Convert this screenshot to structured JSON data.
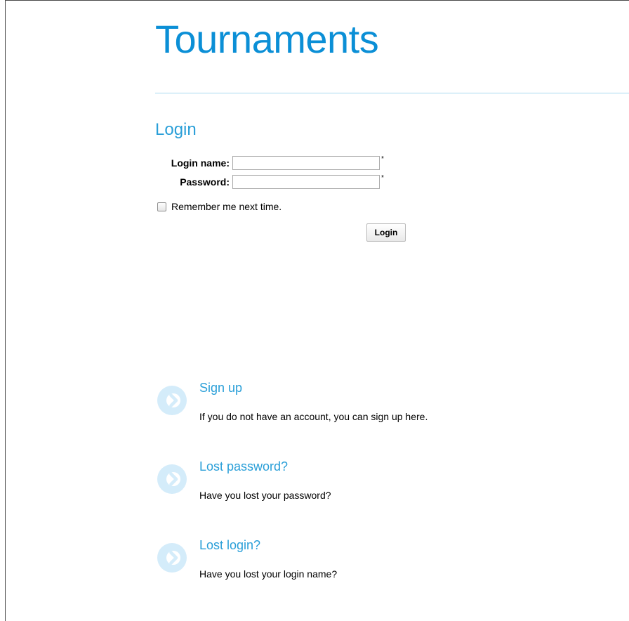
{
  "header": {
    "site_title": "Tournaments"
  },
  "login_form": {
    "heading": "Login",
    "login_name_label": "Login name:",
    "login_name_value": "",
    "password_label": "Password:",
    "password_value": "",
    "required_marker": "*",
    "remember_label": "Remember me next time.",
    "remember_checked": false,
    "submit_label": "Login"
  },
  "links": [
    {
      "title": "Sign up",
      "description": "If you do not have an account, you can sign up here.",
      "icon": "chevron-right-circle-icon"
    },
    {
      "title": "Lost password?",
      "description": "Have you lost your password?",
      "icon": "chevron-right-circle-icon"
    },
    {
      "title": "Lost login?",
      "description": "Have you lost your login name?",
      "icon": "chevron-right-circle-icon"
    }
  ],
  "colors": {
    "accent": "#0b8fd6",
    "heading": "#2a9fd8",
    "icon_circle": "#d4ecfa"
  }
}
